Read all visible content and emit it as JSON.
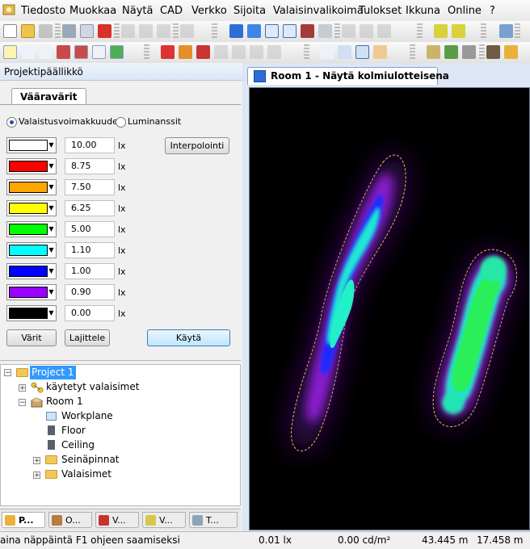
{
  "menu": [
    "Tiedosto",
    "Muokkaa",
    "Näytä",
    "CAD",
    "Verkko",
    "Sijoita",
    "Valaisinvalikoima",
    "Tulokset",
    "Ikkuna",
    "Online",
    "?"
  ],
  "project_panel": {
    "title": "Projektipäällikkö"
  },
  "false_colors": {
    "tab_label": "Vääravärit",
    "radio_illuminance": "Valaistusvoimakkuudet",
    "radio_luminance": "Luminanssit",
    "selected": "illuminance",
    "interpolate_button": "Interpolointi",
    "unit": "lx",
    "levels": [
      {
        "color": "#ffffff",
        "value": "10.00"
      },
      {
        "color": "#ff0000",
        "value": "8.75"
      },
      {
        "color": "#ffa500",
        "value": "7.50"
      },
      {
        "color": "#ffff00",
        "value": "6.25"
      },
      {
        "color": "#00ff00",
        "value": "5.00"
      },
      {
        "color": "#00ffff",
        "value": "1.10"
      },
      {
        "color": "#0000ff",
        "value": "1.00"
      },
      {
        "color": "#9900ff",
        "value": "0.90"
      },
      {
        "color": "#000000",
        "value": "0.00"
      }
    ],
    "colors_button": "Värit",
    "sort_button": "Lajittele",
    "apply_button": "Käytä"
  },
  "tree": {
    "project": "Project 1",
    "used_luminaires": "käytetyt valaisimet",
    "room": "Room 1",
    "children": [
      "Workplane",
      "Floor",
      "Ceiling"
    ],
    "folders": [
      "Seinäpinnat",
      "Valaisimet"
    ]
  },
  "bottom_tabs": [
    "P...",
    "O...",
    "V...",
    "V...",
    "T..."
  ],
  "document": {
    "tab_title": "Room 1 - Näytä kolmiulotteisena"
  },
  "status": {
    "hint": "aina näppäintä F1 ohjeen saamiseksi",
    "illuminance": "0.01 lx",
    "luminance": "0.00 cd/m²",
    "x": "43.445 m",
    "y": "17.458 m"
  }
}
